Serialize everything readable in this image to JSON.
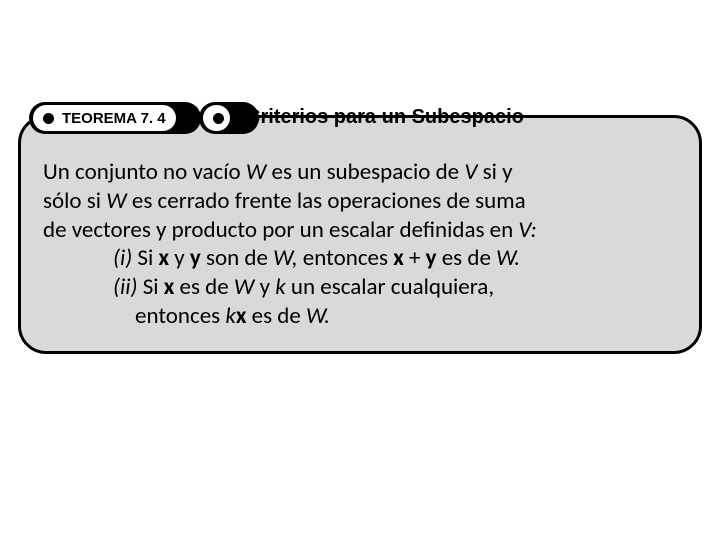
{
  "theorem": {
    "badge_label": "TEOREMA 7. 4",
    "title": "Criterios para un Subespacio",
    "intro_1a": "Un conjunto no vacío ",
    "intro_W1": "W",
    "intro_1b": " es un subespacio de ",
    "intro_V1": "V",
    "intro_1c": " si y",
    "intro_2a": "sólo si ",
    "intro_W2": "W",
    "intro_2b": " es cerrado frente  las operaciones de suma",
    "intro_3a": "de vectores y producto por un escalar definidas en ",
    "intro_V2": "V:",
    "cond_i_a": "(i)",
    "cond_i_b": " Si ",
    "cond_i_x": "x",
    "cond_i_c": " y ",
    "cond_i_y": "y",
    "cond_i_d": " son de ",
    "cond_i_W": "W,",
    "cond_i_e": " entonces ",
    "cond_i_x2": "x",
    "cond_i_plus": " + ",
    "cond_i_y2": "y",
    "cond_i_f": " es de ",
    "cond_i_W2": "W.",
    "cond_ii_a": "(ii)",
    "cond_ii_b": " Si ",
    "cond_ii_x": "x",
    "cond_ii_c": " es de ",
    "cond_ii_W": "W",
    "cond_ii_d": " y ",
    "cond_ii_k": "k",
    "cond_ii_e": " un escalar cualquiera,",
    "cond_ii_f": "entonces ",
    "cond_ii_k2": "k",
    "cond_ii_x2": "x",
    "cond_ii_g": " es de ",
    "cond_ii_W2": "W."
  }
}
